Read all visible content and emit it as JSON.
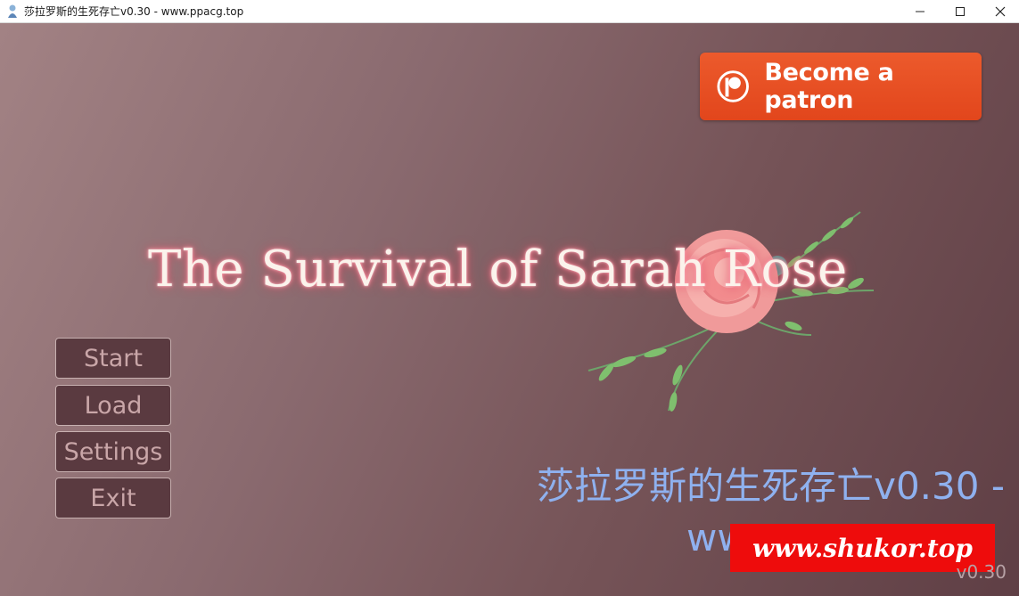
{
  "window": {
    "title": "莎拉罗斯的生死存亡v0.30 - www.ppacg.top",
    "minimize_icon": "minimize-icon",
    "maximize_icon": "maximize-icon",
    "close_icon": "close-icon"
  },
  "patron": {
    "label": "Become a patron",
    "icon": "patreon-logo-icon",
    "color": "#e8501f"
  },
  "game": {
    "title": "The Survival of Sarah Rose",
    "title_glow_color": "#d9485e"
  },
  "menu": {
    "start": "Start",
    "load": "Load",
    "settings": "Settings",
    "exit": "Exit"
  },
  "overlay": {
    "build_line1": "莎拉罗斯的生死存亡v0.30 -",
    "build_line2": "www.ppacg.top",
    "watermark": "www.shukor.top",
    "watermark_color": "#ee0c0c",
    "version": "v0.30"
  }
}
